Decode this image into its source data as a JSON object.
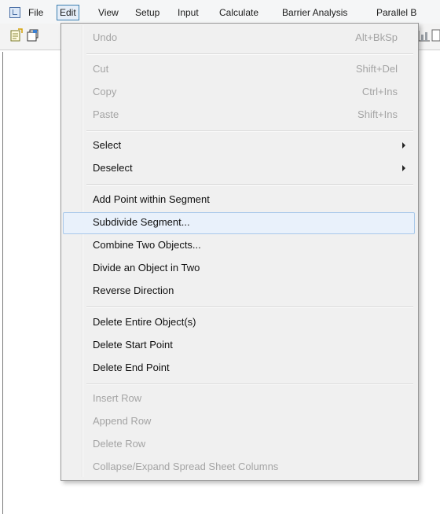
{
  "menubar": {
    "items": [
      "File",
      "Edit",
      "View",
      "Setup",
      "Input",
      "Calculate",
      "Barrier Analysis",
      "Parallel B"
    ],
    "active": "Edit",
    "app_icon": "app-document-icon"
  },
  "toolbar": {
    "left_icons": [
      "new-object-icon",
      "copy-object-icon"
    ],
    "right_icons": [
      "chart-icon",
      "page-icon"
    ]
  },
  "edit_menu": {
    "groups": [
      [
        {
          "label": "Undo",
          "shortcut": "Alt+BkSp",
          "enabled": false
        }
      ],
      [
        {
          "label": "Cut",
          "shortcut": "Shift+Del",
          "enabled": false
        },
        {
          "label": "Copy",
          "shortcut": "Ctrl+Ins",
          "enabled": false
        },
        {
          "label": "Paste",
          "shortcut": "Shift+Ins",
          "enabled": false
        }
      ],
      [
        {
          "label": "Select",
          "submenu": true,
          "enabled": true
        },
        {
          "label": "Deselect",
          "submenu": true,
          "enabled": true
        }
      ],
      [
        {
          "label": "Add Point within Segment",
          "enabled": true
        },
        {
          "label": "Subdivide Segment...",
          "enabled": true,
          "highlighted": true
        },
        {
          "label": "Combine Two Objects...",
          "enabled": true
        },
        {
          "label": "Divide an Object in Two",
          "enabled": true
        },
        {
          "label": "Reverse Direction",
          "enabled": true
        }
      ],
      [
        {
          "label": "Delete Entire Object(s)",
          "enabled": true
        },
        {
          "label": "Delete Start Point",
          "enabled": true
        },
        {
          "label": "Delete End Point",
          "enabled": true
        }
      ],
      [
        {
          "label": "Insert Row",
          "enabled": false
        },
        {
          "label": "Append Row",
          "enabled": false
        },
        {
          "label": "Delete Row",
          "enabled": false
        },
        {
          "label": "Collapse/Expand Spread Sheet Columns",
          "enabled": false
        }
      ]
    ]
  },
  "colors": {
    "highlight_bg": "#e9f1fb",
    "highlight_border": "#a8c8ea",
    "disabled_text": "#a4a4a4",
    "menu_bg": "#f0f0f0"
  }
}
